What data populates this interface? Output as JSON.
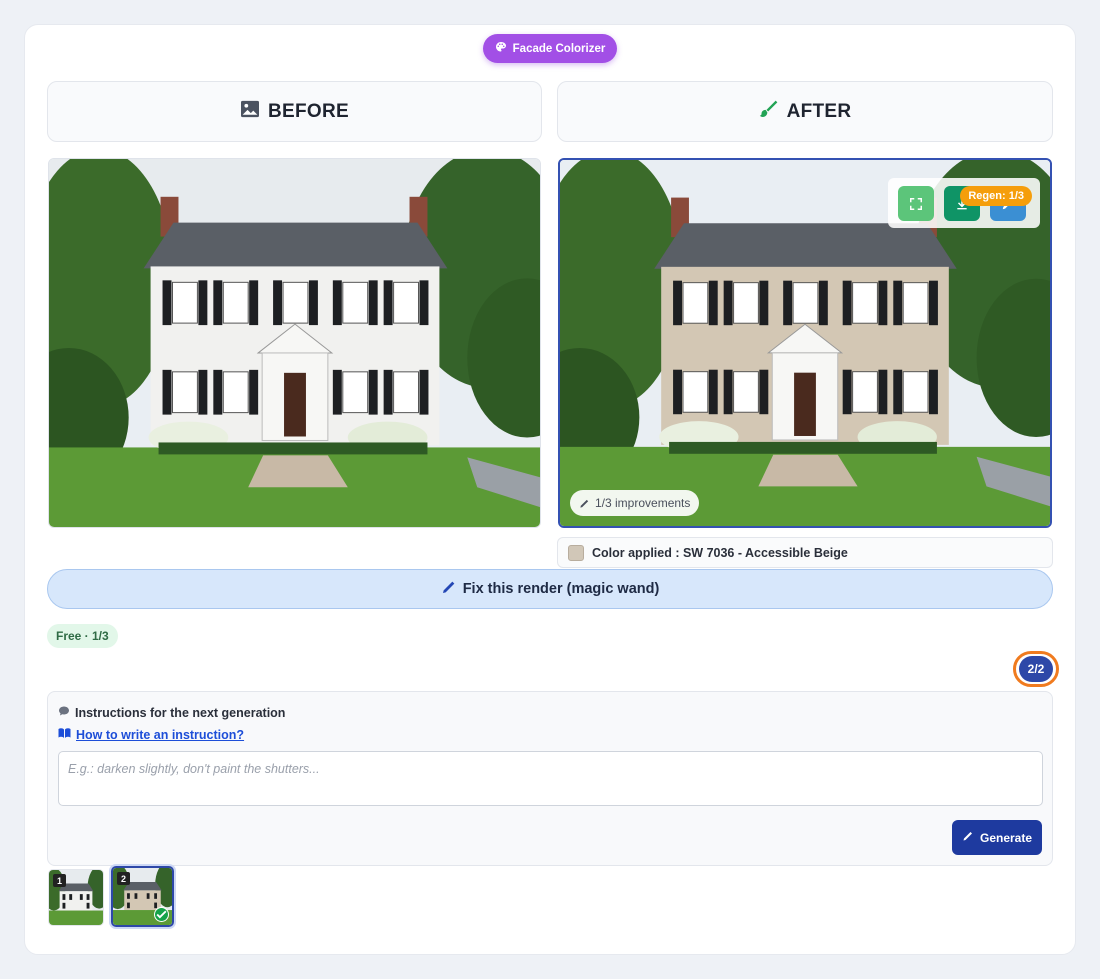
{
  "app": {
    "title": "Facade Colorizer"
  },
  "headers": {
    "before": "BEFORE",
    "after": "AFTER"
  },
  "after_panel": {
    "regen_label": "Regen: 1/3",
    "improvements_label": "1/3 improvements",
    "tools": [
      "fullscreen",
      "download",
      "edit"
    ]
  },
  "color_applied": {
    "label": "Color applied : SW 7036 - Accessible Beige",
    "swatch_color": "#d1c7b8"
  },
  "fix_button": {
    "label": "Fix this render (magic wand)"
  },
  "plan_badge": {
    "label": "Free · 1/3"
  },
  "version_counter": {
    "label": "2/2"
  },
  "instructions": {
    "title": "Instructions for the next generation",
    "help_link": "How to write an instruction?",
    "placeholder": "E.g.: darken slightly, don't paint the shutters...",
    "value": "",
    "generate_label": "Generate"
  },
  "history": {
    "items": [
      {
        "number": "1",
        "selected": false
      },
      {
        "number": "2",
        "selected": true
      }
    ]
  },
  "colors": {
    "accent": "#a24fe6",
    "primary": "#1e3a9f",
    "regen": "#f59e0b",
    "counter_ring": "#f07b1f",
    "wall_before": "#f1f1ef",
    "wall_after": "#d3c7b4"
  }
}
